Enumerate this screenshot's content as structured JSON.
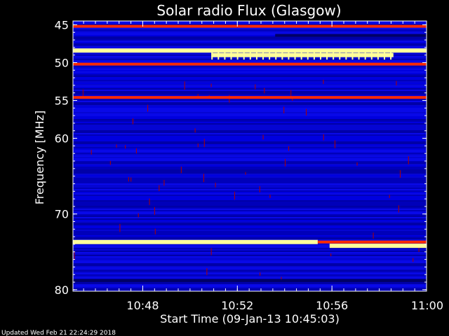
{
  "chart_data": {
    "type": "heatmap",
    "title": "Solar radio Flux (Glasgow)",
    "xlabel": "Start Time (09-Jan-13 10:45:03)",
    "ylabel": "Frequency [MHz]",
    "y_axis": {
      "unit": "MHz",
      "range": [
        44.5,
        80.2
      ],
      "ticks": [
        {
          "value": 45,
          "label": "45"
        },
        {
          "value": 50,
          "label": "50"
        },
        {
          "value": 55,
          "label": "55"
        },
        {
          "value": 60,
          "label": "60"
        },
        {
          "value": 70,
          "label": "70"
        },
        {
          "value": 80,
          "label": "80"
        }
      ]
    },
    "x_axis": {
      "unit": "minutes",
      "range_minutes": [
        45.05,
        60
      ],
      "ticks": [
        {
          "value": 48,
          "label": "10:48"
        },
        {
          "value": 52,
          "label": "10:52"
        },
        {
          "value": 56,
          "label": "10:56"
        },
        {
          "value": 60,
          "label": "11:00"
        }
      ]
    },
    "colors": {
      "background": "#0000cc",
      "high": "#ffff9a",
      "strong": "#ff2a00",
      "medium": "#aa0000",
      "dark": "#000066"
    },
    "bands": [
      {
        "freq": 45.2,
        "level": "strong",
        "from": 45.05,
        "to": 60
      },
      {
        "freq": 46.4,
        "level": "dark",
        "from": 53.6,
        "to": 60
      },
      {
        "freq": 48.4,
        "level": "high",
        "from": 45.05,
        "to": 60
      },
      {
        "freq": 49.0,
        "level": "high",
        "from": 50.9,
        "to": 58.6
      },
      {
        "freq": 50.2,
        "level": "strong",
        "from": 45.05,
        "to": 60
      },
      {
        "freq": 54.6,
        "level": "strong",
        "from": 45.05,
        "to": 60
      },
      {
        "freq": 73.7,
        "level": "high",
        "from": 45.05,
        "to": 55.4
      },
      {
        "freq": 73.7,
        "level": "strong",
        "from": 55.4,
        "to": 60
      },
      {
        "freq": 74.2,
        "level": "high",
        "from": 55.9,
        "to": 60
      },
      {
        "freq": 78.8,
        "level": "dark",
        "from": 45.05,
        "to": 60
      }
    ]
  },
  "footer": {
    "updated": "Updated Wed Feb 21 22:24:29 2018"
  }
}
